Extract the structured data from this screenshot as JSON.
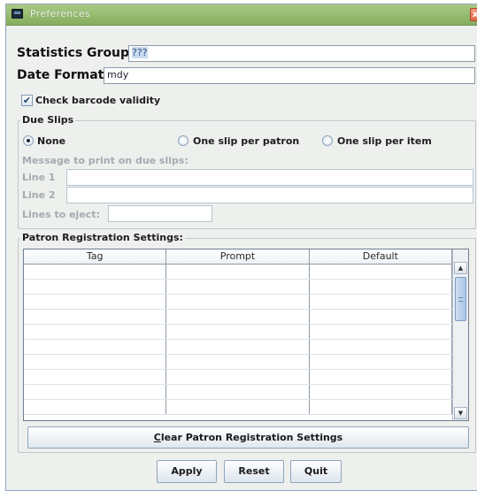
{
  "window": {
    "title": "Preferences",
    "close_glyph": "x"
  },
  "form": {
    "statistics_group_label": "Statistics Group:",
    "statistics_group_value": "???",
    "date_format_label": "Date Format:",
    "date_format_value": "mdy",
    "check_barcode_label": "Check barcode validity",
    "check_barcode_checked": true,
    "check_mark": "✔"
  },
  "due_slips": {
    "title": "Due Slips",
    "options": [
      {
        "label": "None",
        "selected": true
      },
      {
        "label": "One slip per patron",
        "selected": false
      },
      {
        "label": "One slip per item",
        "selected": false
      }
    ],
    "message_label": "Message to print on due slips:",
    "line1_label": "Line 1",
    "line1_value": "",
    "line2_label": "Line 2",
    "line2_value": "",
    "eject_label": "Lines to eject:",
    "eject_value": ""
  },
  "patron_registration": {
    "title": "Patron Registration Settings:",
    "columns": [
      "Tag",
      "Prompt",
      "Default"
    ],
    "rows": [
      [
        "",
        "",
        ""
      ],
      [
        "",
        "",
        ""
      ],
      [
        "",
        "",
        ""
      ],
      [
        "",
        "",
        ""
      ],
      [
        "",
        "",
        ""
      ],
      [
        "",
        "",
        ""
      ],
      [
        "",
        "",
        ""
      ],
      [
        "",
        "",
        ""
      ],
      [
        "",
        "",
        ""
      ],
      [
        "",
        "",
        ""
      ]
    ],
    "clear_button": "Clear Patron Registration Settings",
    "clear_mnemonic": "C",
    "clear_rest": "lear Patron Registration Settings",
    "scroll_up_icon": "▲",
    "scroll_down_icon": "▼"
  },
  "actions": {
    "apply": "Apply",
    "reset": "Reset",
    "quit": "Quit"
  }
}
